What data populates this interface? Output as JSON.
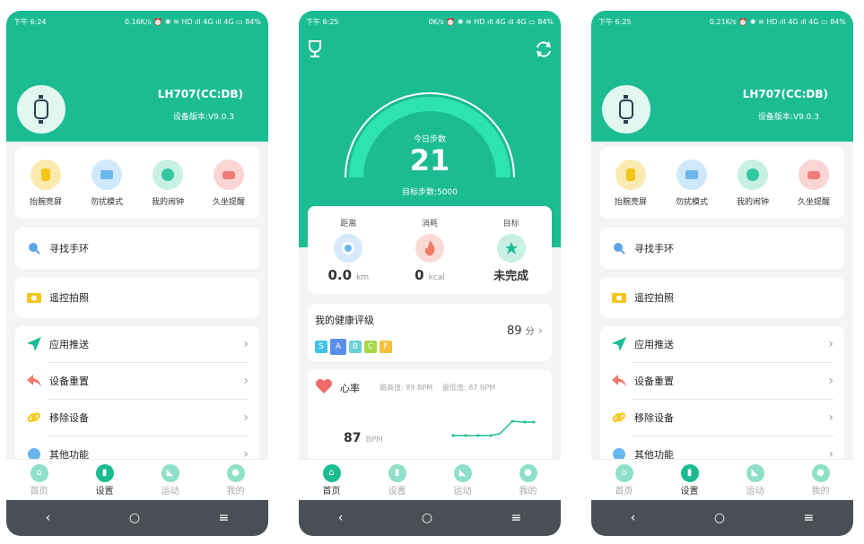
{
  "phone1": {
    "status": {
      "time": "下午 6:24",
      "right": "0.16K/s ⏰ ✱ ≋ HD ıll 4G ıll 4G ▭ 84%"
    },
    "device": {
      "name": "LH707(CC:DB)",
      "version": "设备版本:V9.0.3"
    },
    "quick": [
      "抬腕亮屏",
      "勿扰模式",
      "我的闹钟",
      "久坐提醒"
    ],
    "find_band": "寻找手环",
    "remote_photo": "遥控拍照",
    "menu": [
      "应用推送",
      "设备重置",
      "移除设备",
      "其他功能"
    ]
  },
  "phone2": {
    "status": {
      "time": "下午 6:25",
      "right": "0K/s ⏰ ✱ ≋ HD ıll 4G ıll 4G ▭ 84%"
    },
    "steps_label": "今日步数",
    "steps": "21",
    "goal": "目标步数:5000",
    "metrics": [
      {
        "title": "距离",
        "value": "0.0",
        "unit": "km"
      },
      {
        "title": "消耗",
        "value": "0",
        "unit": "kcal"
      },
      {
        "title": "目标",
        "value": "未完成",
        "unit": ""
      }
    ],
    "health": {
      "title": "我的健康评级",
      "grades": [
        "S",
        "A",
        "B",
        "C",
        "F"
      ],
      "score": "89",
      "score_unit": "分"
    },
    "heart": {
      "title": "心率",
      "max": "最高值: 89 BPM",
      "min": "最低值: 87 BPM",
      "value": "87",
      "unit": "BPM"
    }
  },
  "phone3": {
    "status": {
      "time": "下午 6:25",
      "right": "0.21K/s ⏰ ✱ ≋ HD ıll 4G ıll 4G ▭ 84%"
    },
    "device": {
      "name": "LH707(CC:DB)",
      "version": "设备版本:V9.0.3"
    },
    "quick": [
      "抬腕亮屏",
      "勿扰模式",
      "我的闹钟",
      "久坐提醒"
    ],
    "find_band": "寻找手环",
    "remote_photo": "遥控拍照",
    "menu": [
      "应用推送",
      "设备重置",
      "移除设备",
      "其他功能"
    ]
  },
  "tabs": [
    "首页",
    "设置",
    "运动",
    "我的"
  ],
  "nav": {
    "back": "‹",
    "home": "○",
    "menu": "≡"
  },
  "colors": {
    "primary": "#1cbc93",
    "nav": "#4a4f55",
    "heart": "#f06a6a"
  }
}
